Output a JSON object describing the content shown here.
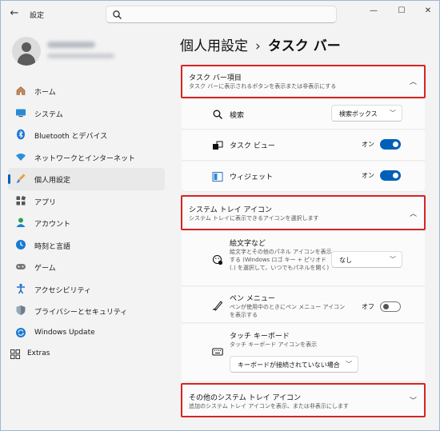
{
  "app": {
    "title": "設定"
  },
  "window": {
    "minimize": "—",
    "maximize": "☐",
    "close": "✕",
    "back": "←"
  },
  "search": {
    "placeholder": ""
  },
  "sidebar": {
    "items": [
      {
        "label": "ホーム",
        "icon": "home-icon",
        "active": false
      },
      {
        "label": "システム",
        "icon": "system-icon",
        "active": false
      },
      {
        "label": "Bluetooth とデバイス",
        "icon": "bluetooth-icon",
        "active": false
      },
      {
        "label": "ネットワークとインターネット",
        "icon": "wifi-icon",
        "active": false
      },
      {
        "label": "個人用設定",
        "icon": "brush-icon",
        "active": true
      },
      {
        "label": "アプリ",
        "icon": "apps-icon",
        "active": false
      },
      {
        "label": "アカウント",
        "icon": "account-icon",
        "active": false
      },
      {
        "label": "時刻と言語",
        "icon": "time-language-icon",
        "active": false
      },
      {
        "label": "ゲーム",
        "icon": "gamepad-icon",
        "active": false
      },
      {
        "label": "アクセシビリティ",
        "icon": "accessibility-icon",
        "active": false
      },
      {
        "label": "プライバシーとセキュリティ",
        "icon": "shield-icon",
        "active": false
      },
      {
        "label": "Windows Update",
        "icon": "windows-update-icon",
        "active": false
      }
    ],
    "extras": {
      "label": "Extras",
      "icon": "extras-icon"
    }
  },
  "breadcrumb": {
    "parent": "個人用設定",
    "separator": "›",
    "current": "タスク バー"
  },
  "taskbar_items": {
    "title": "タスク バー項目",
    "subtitle": "タスク バーに表示されるボタンを表示または非表示にする",
    "search": {
      "label": "検索",
      "value": "検索ボックス"
    },
    "taskview": {
      "label": "タスク ビュー",
      "state": "オン"
    },
    "widgets": {
      "label": "ウィジェット",
      "state": "オン"
    }
  },
  "system_tray": {
    "title": "システム トレイ アイコン",
    "subtitle": "システム トレイに表示できるアイコンを選択します",
    "emoji": {
      "label": "絵文字など",
      "desc": "絵文字とその他のパネル アイコンを表示する (Windows ロゴ キー + ピリオド (.) を選択して、いつでもパネルを開く)",
      "value": "なし"
    },
    "pen": {
      "label": "ペン メニュー",
      "desc": "ペンが使用中のときにペン メニュー アイコンを表示する",
      "state": "オフ"
    },
    "touch_keyboard": {
      "label": "タッチ キーボード",
      "desc": "タッチ キーボード アイコンを表示",
      "value": "キーボードが接続されていない場合"
    }
  },
  "other_tray": {
    "title": "その他のシステム トレイ アイコン",
    "subtitle": "追加のシステム トレイ アイコンを表示、または非表示にします"
  },
  "colors": {
    "accent": "#005fb8",
    "highlight": "#d72323"
  }
}
